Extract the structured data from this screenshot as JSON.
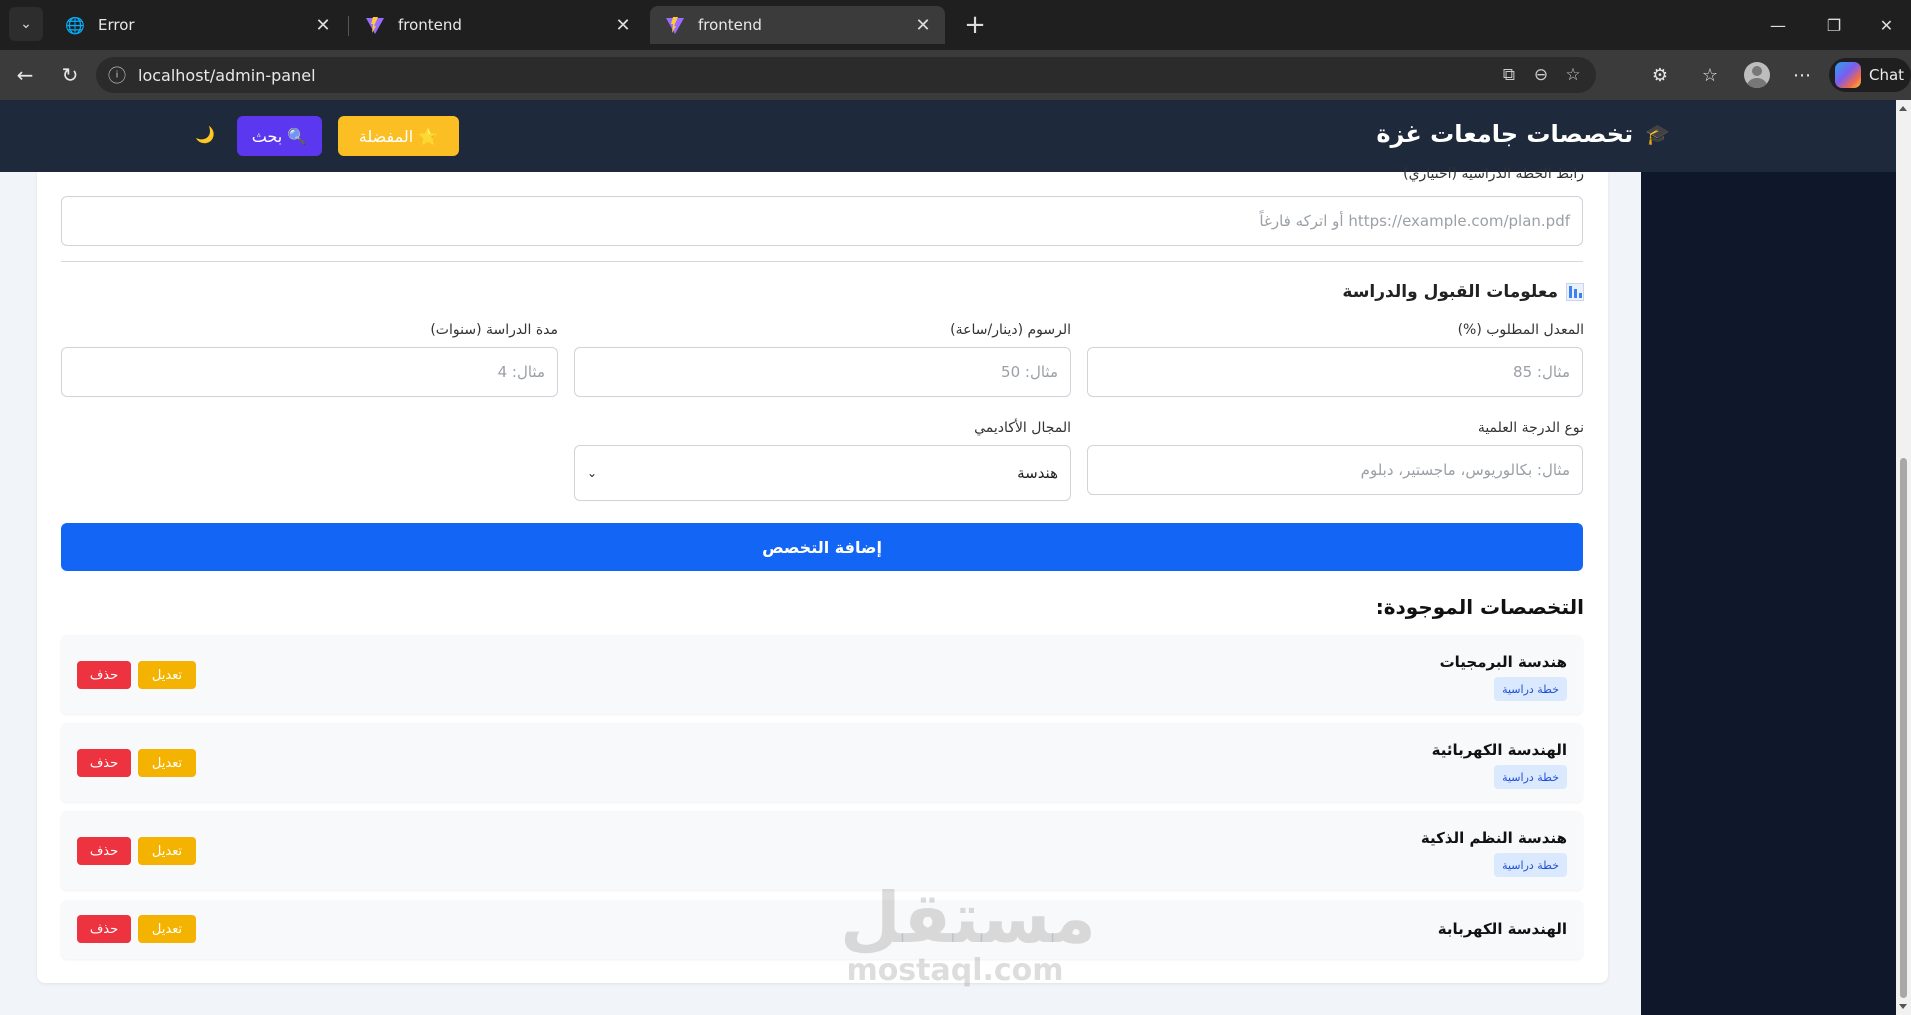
{
  "browser": {
    "tabs": [
      {
        "title": "Error",
        "icon": "globe-icon",
        "active": false
      },
      {
        "title": "frontend",
        "icon": "vite-icon",
        "active": false
      },
      {
        "title": "frontend",
        "icon": "vite-icon",
        "active": true
      }
    ],
    "url": "localhost/admin-panel",
    "chat_label": "Chat"
  },
  "header": {
    "title": "تخصصات جامعات غزة",
    "favorites_label": "⭐ المفضلة",
    "search_label": "🔍 بحث",
    "theme_icon": "🌙"
  },
  "form": {
    "plan_link_label": "رابط الخطة الدراسية (اختياري)",
    "plan_link_placeholder": "https://example.com/plan.pdf أو اتركه فارغاً",
    "section_title": "معلومات القبول والدراسة",
    "required_gpa_label": "المعدل المطلوب (%)",
    "required_gpa_placeholder": "مثال: 85",
    "fees_label": "الرسوم (دينار/ساعة)",
    "fees_placeholder": "مثال: 50",
    "duration_label": "مدة الدراسة (سنوات)",
    "duration_placeholder": "مثال: 4",
    "degree_label": "نوع الدرجة العلمية",
    "degree_placeholder": "مثال: بكالوريوس، ماجستير، دبلوم",
    "field_label": "المجال الأكاديمي",
    "field_value": "هندسة",
    "submit_label": "إضافة التخصص"
  },
  "list": {
    "title": "التخصصات الموجودة:",
    "edit_label": "تعديل",
    "delete_label": "حذف",
    "plan_badge": "خطة دراسية",
    "items": [
      {
        "name": "هندسة البرمجيات",
        "has_plan": true
      },
      {
        "name": "الهندسة الكهربائية",
        "has_plan": true
      },
      {
        "name": "هندسة النظم الذكية",
        "has_plan": true
      },
      {
        "name": "الهندسة الكهربابة",
        "has_plan": false
      }
    ]
  },
  "watermark": {
    "arabic": "مستقل",
    "latin": "mostaql.com"
  },
  "colors": {
    "primary": "#1366f5",
    "warning": "#f5b301",
    "danger": "#ee3340",
    "header_bg": "#1e293b"
  }
}
